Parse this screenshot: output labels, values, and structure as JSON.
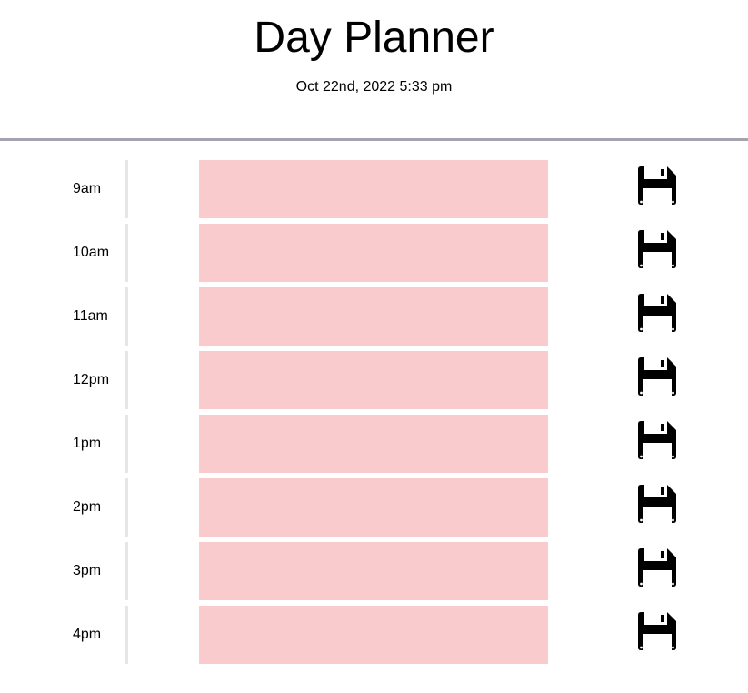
{
  "header": {
    "title": "Day Planner",
    "date": "Oct 22nd, 2022 5:33 pm"
  },
  "rows": [
    {
      "hour": "9am",
      "text": ""
    },
    {
      "hour": "10am",
      "text": ""
    },
    {
      "hour": "11am",
      "text": ""
    },
    {
      "hour": "12pm",
      "text": ""
    },
    {
      "hour": "1pm",
      "text": ""
    },
    {
      "hour": "2pm",
      "text": ""
    },
    {
      "hour": "3pm",
      "text": ""
    },
    {
      "hour": "4pm",
      "text": ""
    }
  ],
  "save_icon": "floppy-disk-icon",
  "colors": {
    "entry_bg": "#f9cbcd",
    "divider": "#e6e6e6",
    "header_rule": "#a3a4b0"
  }
}
